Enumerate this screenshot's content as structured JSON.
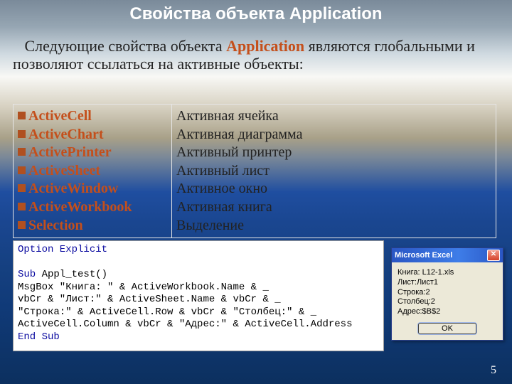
{
  "title": "Свойства объекта Application",
  "intro_leading_spaces": "   ",
  "intro_before": "Следующие свойства объекта ",
  "intro_highlight": "Application",
  "intro_after": " являются глобальными и позволяют ссылаться на активные объекты:",
  "properties": [
    "ActiveCell",
    "ActiveChart",
    "ActivePrinter",
    "ActiveSheet",
    "ActiveWindow",
    "ActiveWorkbook",
    "Selection"
  ],
  "descriptions": [
    "Активная ячейка",
    "Активная диаграмма",
    "Активный принтер",
    "Активный лист",
    "Активное окно",
    "Активная книга",
    "Выделение"
  ],
  "code": {
    "l1_kw": "Option Explicit",
    "l2": "",
    "l3a": "Sub",
    "l3b": " Appl_test()",
    "l4": "MsgBox \"Книга: \" & ActiveWorkbook.Name & _",
    "l5": "vbCr & \"Лист:\" & ActiveSheet.Name & vbCr & _",
    "l6": "\"Строка:\" & ActiveCell.Row & vbCr & \"Столбец:\" & _",
    "l7": "ActiveCell.Column & vbCr & \"Адрес:\" & ActiveCell.Address",
    "l8_kw": "End Sub"
  },
  "msgbox": {
    "title": "Microsoft Excel",
    "close_glyph": "✕",
    "body": "Книга: L12-1.xls\nЛист:Лист1\nСтрока:2\nСтолбец:2\nАдрес:$B$2",
    "ok": "OK"
  },
  "page_number": "5"
}
